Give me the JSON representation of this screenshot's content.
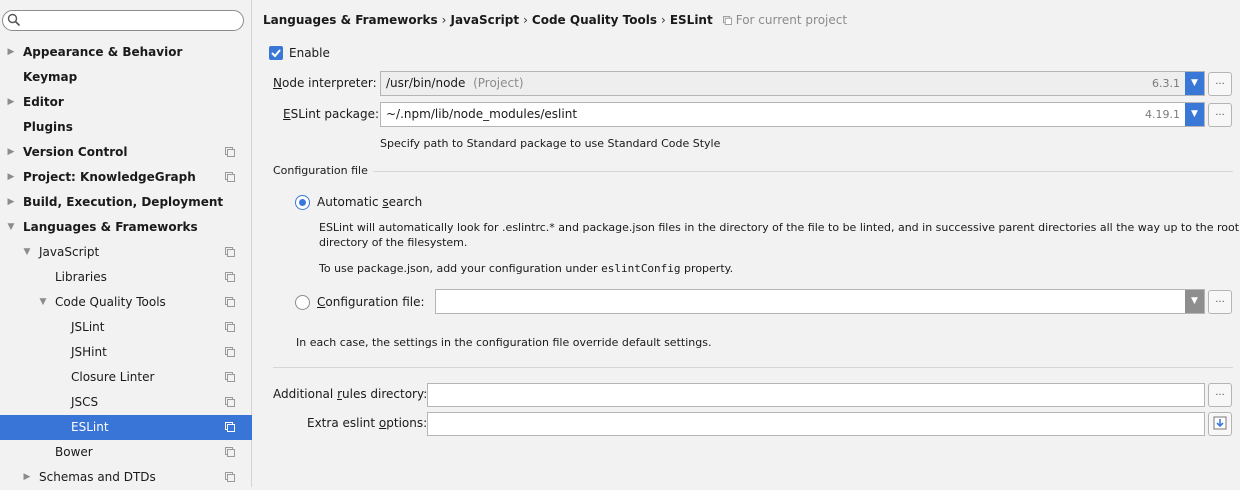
{
  "sidebar": {
    "search": {
      "placeholder": ""
    },
    "items": [
      {
        "label": "Appearance & Behavior",
        "arrow": "▶",
        "scope": false
      },
      {
        "label": "Keymap",
        "arrow": "",
        "scope": false
      },
      {
        "label": "Editor",
        "arrow": "▶",
        "scope": false
      },
      {
        "label": "Plugins",
        "arrow": "",
        "scope": false
      },
      {
        "label": "Version Control",
        "arrow": "▶",
        "scope": true
      },
      {
        "label": "Project: KnowledgeGraph",
        "arrow": "▶",
        "scope": true
      },
      {
        "label": "Build, Execution, Deployment",
        "arrow": "▶",
        "scope": false
      },
      {
        "label": "Languages & Frameworks",
        "arrow": "▼",
        "scope": false
      },
      {
        "label": "JavaScript",
        "arrow": "▼",
        "scope": true
      },
      {
        "label": "Libraries",
        "arrow": "",
        "scope": true
      },
      {
        "label": "Code Quality Tools",
        "arrow": "▼",
        "scope": true
      },
      {
        "label": "JSLint",
        "arrow": "",
        "scope": true
      },
      {
        "label": "JSHint",
        "arrow": "",
        "scope": true
      },
      {
        "label": "Closure Linter",
        "arrow": "",
        "scope": true
      },
      {
        "label": "JSCS",
        "arrow": "",
        "scope": true
      },
      {
        "label": "ESLint",
        "arrow": "",
        "scope": true,
        "selected": true
      },
      {
        "label": "Bower",
        "arrow": "",
        "scope": true
      },
      {
        "label": "Schemas and DTDs",
        "arrow": "▶",
        "scope": true
      }
    ]
  },
  "breadcrumb": {
    "parts": [
      "Languages & Frameworks",
      "JavaScript",
      "Code Quality Tools",
      "ESLint"
    ],
    "separator": "›",
    "scope_note": "For current project"
  },
  "enable": {
    "label": "Enable",
    "checked": true
  },
  "node_interpreter": {
    "label_pre": "N",
    "label_post": "ode interpreter:",
    "value": "/usr/bin/node",
    "suffix": "(Project)",
    "version": "6.3.1"
  },
  "eslint_package": {
    "label_pre": "E",
    "label_post": "SLint package:",
    "value": "~/.npm/lib/node_modules/eslint",
    "version": "4.19.1",
    "hint": "Specify path to Standard package to use Standard Code Style"
  },
  "config": {
    "section_title": "Configuration file",
    "auto_label_pre": "Automatic ",
    "auto_label_u": "s",
    "auto_label_post": "earch",
    "auto_desc_1": "ESLint will automatically look for .eslintrc.* and package.json files in the directory of the file to be linted, and in successive parent directories all the way up to the root",
    "auto_desc_2": "directory of the filesystem.",
    "pkg_note_pre": "To use package.json, add your configuration under ",
    "pkg_note_code": "eslintConfig",
    "pkg_note_post": " property.",
    "file_label_u": "C",
    "file_label_post": "onfiguration file:",
    "file_value": "",
    "override_note": "In each case, the settings in the configuration file override default settings."
  },
  "additional_rules": {
    "label_pre": "Additional ",
    "label_u": "r",
    "label_post": "ules directory:",
    "value": ""
  },
  "extra_options": {
    "label_pre": "Extra eslint ",
    "label_u": "o",
    "label_post": "ptions:",
    "value": ""
  },
  "ellipsis": "...",
  "colors": {
    "accent": "#3a78d8",
    "selection": "#3875d7"
  }
}
